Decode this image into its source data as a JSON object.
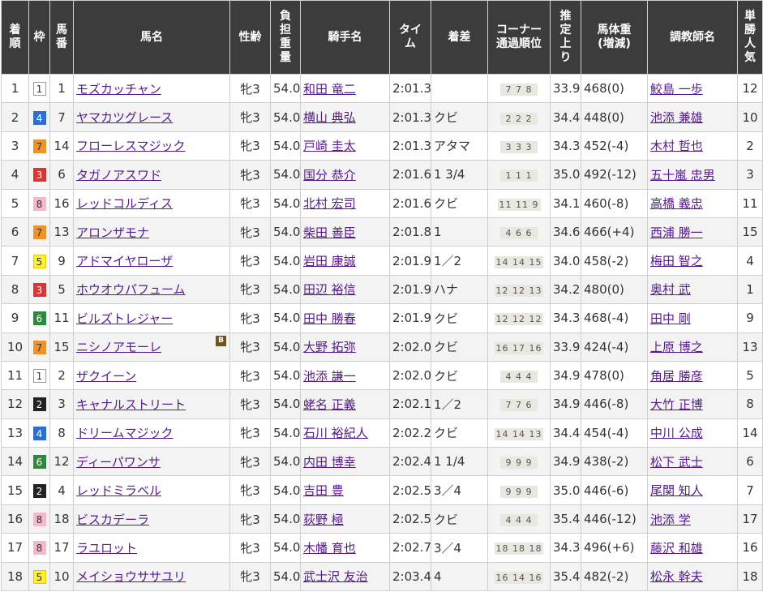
{
  "headers": {
    "rank": "着順",
    "waku": "枠",
    "umaban": "馬番",
    "horse": "馬名",
    "sexage": "性齢",
    "weight": "負担重量",
    "jockey": "騎手名",
    "time": "タイム",
    "margin": "着差",
    "corner": "コーナー通過順位",
    "last3f": "推定上り",
    "bodyweight": "馬体重(増減)",
    "trainer": "調教師名",
    "pop": "単勝人気"
  },
  "waku_colors": {
    "1": {
      "bg": "#ffffff",
      "fg": "#333333",
      "border": "#999999"
    },
    "2": {
      "bg": "#222222",
      "fg": "#ffffff",
      "border": "#222222"
    },
    "3": {
      "bg": "#dd3333",
      "fg": "#ffffff",
      "border": "#dd3333"
    },
    "4": {
      "bg": "#2b6fd6",
      "fg": "#ffffff",
      "border": "#2b6fd6"
    },
    "5": {
      "bg": "#ffee33",
      "fg": "#333333",
      "border": "#e0cc00"
    },
    "6": {
      "bg": "#2d8a3d",
      "fg": "#ffffff",
      "border": "#2d8a3d"
    },
    "7": {
      "bg": "#f0922c",
      "fg": "#333333",
      "border": "#f0922c"
    },
    "8": {
      "bg": "#f7b8c8",
      "fg": "#333333",
      "border": "#f7b8c8"
    }
  },
  "rows": [
    {
      "rank": "1",
      "waku": "1",
      "umaban": "1",
      "horse": "モズカッチャン",
      "sexage": "牝3",
      "weight": "54.0",
      "jockey": "和田 竜二",
      "time": "2:01.3",
      "margin": "",
      "corner": "7 7 8",
      "last3f": "33.9",
      "bodyweight": "468(0)",
      "trainer": "鮫島 一歩",
      "pop": "12"
    },
    {
      "rank": "2",
      "waku": "4",
      "umaban": "7",
      "horse": "ヤマカツグレース",
      "sexage": "牝3",
      "weight": "54.0",
      "jockey": "横山 典弘",
      "time": "2:01.3",
      "margin": "クビ",
      "corner": "2 2 2",
      "last3f": "34.4",
      "bodyweight": "448(0)",
      "trainer": "池添 兼雄",
      "pop": "10"
    },
    {
      "rank": "3",
      "waku": "7",
      "umaban": "14",
      "horse": "フローレスマジック",
      "sexage": "牝3",
      "weight": "54.0",
      "jockey": "戸崎 圭太",
      "time": "2:01.3",
      "margin": "アタマ",
      "corner": "3 3 3",
      "last3f": "34.3",
      "bodyweight": "452(-4)",
      "trainer": "木村 哲也",
      "pop": "2"
    },
    {
      "rank": "4",
      "waku": "3",
      "umaban": "6",
      "horse": "タガノアスワド",
      "sexage": "牝3",
      "weight": "54.0",
      "jockey": "国分 恭介",
      "time": "2:01.6",
      "margin": "1 3/4",
      "corner": "1 1 1",
      "last3f": "35.0",
      "bodyweight": "492(-12)",
      "trainer": "五十嵐 忠男",
      "pop": "3"
    },
    {
      "rank": "5",
      "waku": "8",
      "umaban": "16",
      "horse": "レッドコルディス",
      "sexage": "牝3",
      "weight": "54.0",
      "jockey": "北村 宏司",
      "time": "2:01.6",
      "margin": "クビ",
      "corner": "11 11 9",
      "last3f": "34.1",
      "bodyweight": "460(-8)",
      "trainer": "高橋 義忠",
      "pop": "11"
    },
    {
      "rank": "6",
      "waku": "7",
      "umaban": "13",
      "horse": "アロンザモナ",
      "sexage": "牝3",
      "weight": "54.0",
      "jockey": "柴田 善臣",
      "time": "2:01.8",
      "margin": "1",
      "corner": "4 6 6",
      "last3f": "34.6",
      "bodyweight": "466(+4)",
      "trainer": "西浦 勝一",
      "pop": "15"
    },
    {
      "rank": "7",
      "waku": "5",
      "umaban": "9",
      "horse": "アドマイヤローザ",
      "sexage": "牝3",
      "weight": "54.0",
      "jockey": "岩田 康誠",
      "time": "2:01.9",
      "margin": "1／2",
      "corner": "14 14 15",
      "last3f": "34.0",
      "bodyweight": "458(-2)",
      "trainer": "梅田 智之",
      "pop": "4"
    },
    {
      "rank": "8",
      "waku": "3",
      "umaban": "5",
      "horse": "ホウオウパフューム",
      "sexage": "牝3",
      "weight": "54.0",
      "jockey": "田辺 裕信",
      "time": "2:01.9",
      "margin": "ハナ",
      "corner": "12 12 13",
      "last3f": "34.2",
      "bodyweight": "480(0)",
      "trainer": "奥村 武",
      "pop": "1"
    },
    {
      "rank": "9",
      "waku": "6",
      "umaban": "11",
      "horse": "ビルズトレジャー",
      "sexage": "牝3",
      "weight": "54.0",
      "jockey": "田中 勝春",
      "time": "2:01.9",
      "margin": "クビ",
      "corner": "12 12 12",
      "last3f": "34.3",
      "bodyweight": "468(-4)",
      "trainer": "田中 剛",
      "pop": "9"
    },
    {
      "rank": "10",
      "waku": "7",
      "umaban": "15",
      "horse": "ニシノアモーレ",
      "blinker": "B",
      "sexage": "牝3",
      "weight": "54.0",
      "jockey": "大野 拓弥",
      "time": "2:02.0",
      "margin": "クビ",
      "corner": "16 17 16",
      "last3f": "33.9",
      "bodyweight": "424(-4)",
      "trainer": "上原 博之",
      "pop": "13"
    },
    {
      "rank": "11",
      "waku": "1",
      "umaban": "2",
      "horse": "ザクイーン",
      "sexage": "牝3",
      "weight": "54.0",
      "jockey": "池添 謙一",
      "time": "2:02.0",
      "margin": "クビ",
      "corner": "4 4 4",
      "last3f": "34.9",
      "bodyweight": "478(0)",
      "trainer": "角居 勝彦",
      "pop": "5"
    },
    {
      "rank": "12",
      "waku": "2",
      "umaban": "3",
      "horse": "キャナルストリート",
      "sexage": "牝3",
      "weight": "54.0",
      "jockey": "蛯名 正義",
      "time": "2:02.1",
      "margin": "1／2",
      "corner": "7 7 6",
      "last3f": "34.9",
      "bodyweight": "446(-8)",
      "trainer": "大竹 正博",
      "pop": "8"
    },
    {
      "rank": "13",
      "waku": "4",
      "umaban": "8",
      "horse": "ドリームマジック",
      "sexage": "牝3",
      "weight": "54.0",
      "jockey": "石川 裕紀人",
      "time": "2:02.2",
      "margin": "クビ",
      "corner": "14 14 13",
      "last3f": "34.4",
      "bodyweight": "454(-4)",
      "trainer": "中川 公成",
      "pop": "14"
    },
    {
      "rank": "14",
      "waku": "6",
      "umaban": "12",
      "horse": "ディーパワンサ",
      "sexage": "牝3",
      "weight": "54.0",
      "jockey": "内田 博幸",
      "time": "2:02.4",
      "margin": "1 1/4",
      "corner": "9 9 9",
      "last3f": "34.9",
      "bodyweight": "438(-2)",
      "trainer": "松下 武士",
      "pop": "6"
    },
    {
      "rank": "15",
      "waku": "2",
      "umaban": "4",
      "horse": "レッドミラベル",
      "sexage": "牝3",
      "weight": "54.0",
      "jockey": "吉田 豊",
      "time": "2:02.5",
      "margin": "3／4",
      "corner": "9 9 9",
      "last3f": "35.0",
      "bodyweight": "446(-6)",
      "trainer": "尾関 知人",
      "pop": "7"
    },
    {
      "rank": "16",
      "waku": "8",
      "umaban": "18",
      "horse": "ビスカデーラ",
      "sexage": "牝3",
      "weight": "54.0",
      "jockey": "荻野 極",
      "time": "2:02.5",
      "margin": "クビ",
      "corner": "4 4 4",
      "last3f": "35.4",
      "bodyweight": "446(-12)",
      "trainer": "池添 学",
      "pop": "17"
    },
    {
      "rank": "17",
      "waku": "8",
      "umaban": "17",
      "horse": "ラユロット",
      "sexage": "牝3",
      "weight": "54.0",
      "jockey": "木幡 育也",
      "time": "2:02.7",
      "margin": "3／4",
      "corner": "18 18 18",
      "last3f": "34.3",
      "bodyweight": "496(+6)",
      "trainer": "藤沢 和雄",
      "pop": "16"
    },
    {
      "rank": "18",
      "waku": "5",
      "umaban": "10",
      "horse": "メイショウササユリ",
      "sexage": "牝3",
      "weight": "54.0",
      "jockey": "武士沢 友治",
      "time": "2:03.4",
      "margin": "4",
      "corner": "16 14 16",
      "last3f": "35.4",
      "bodyweight": "482(-2)",
      "trainer": "松永 幹夫",
      "pop": "18"
    }
  ]
}
